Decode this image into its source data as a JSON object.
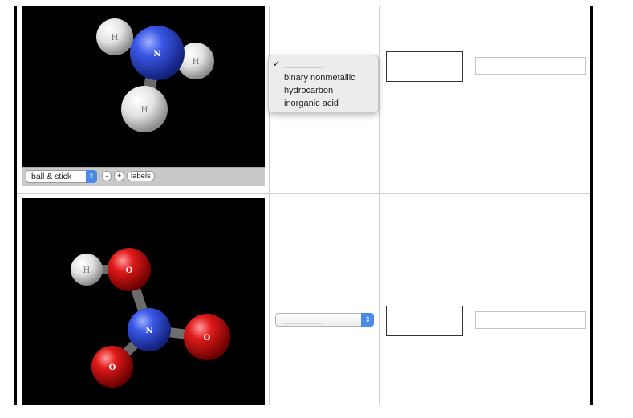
{
  "molecule_viewer": {
    "style_select_value": "ball & stick",
    "zoom_out_label": "-",
    "zoom_in_label": "+",
    "labels_button": "labels"
  },
  "molecule_1": {
    "atoms": [
      {
        "symbol": "N",
        "element": "nitrogen",
        "color": "#2f4fd8"
      },
      {
        "symbol": "H",
        "element": "hydrogen",
        "color": "#dddddd"
      },
      {
        "symbol": "H",
        "element": "hydrogen",
        "color": "#dddddd"
      },
      {
        "symbol": "H",
        "element": "hydrogen",
        "color": "#dddddd"
      }
    ]
  },
  "molecule_2": {
    "atoms": [
      {
        "symbol": "H",
        "element": "hydrogen",
        "color": "#dddddd"
      },
      {
        "symbol": "O",
        "element": "oxygen",
        "color": "#d81818"
      },
      {
        "symbol": "N",
        "element": "nitrogen",
        "color": "#2f4fd8"
      },
      {
        "symbol": "O",
        "element": "oxygen",
        "color": "#d81818"
      },
      {
        "symbol": "O",
        "element": "oxygen",
        "color": "#d81818"
      }
    ]
  },
  "classification_dropdown": {
    "options": [
      "________",
      "binary nonmetallic",
      "hydrocarbon",
      "inorganic acid"
    ],
    "selected_index": 0,
    "check_mark": "✓"
  },
  "row_2": {
    "classification_select_value": "________",
    "select_arrows": "⇕"
  }
}
